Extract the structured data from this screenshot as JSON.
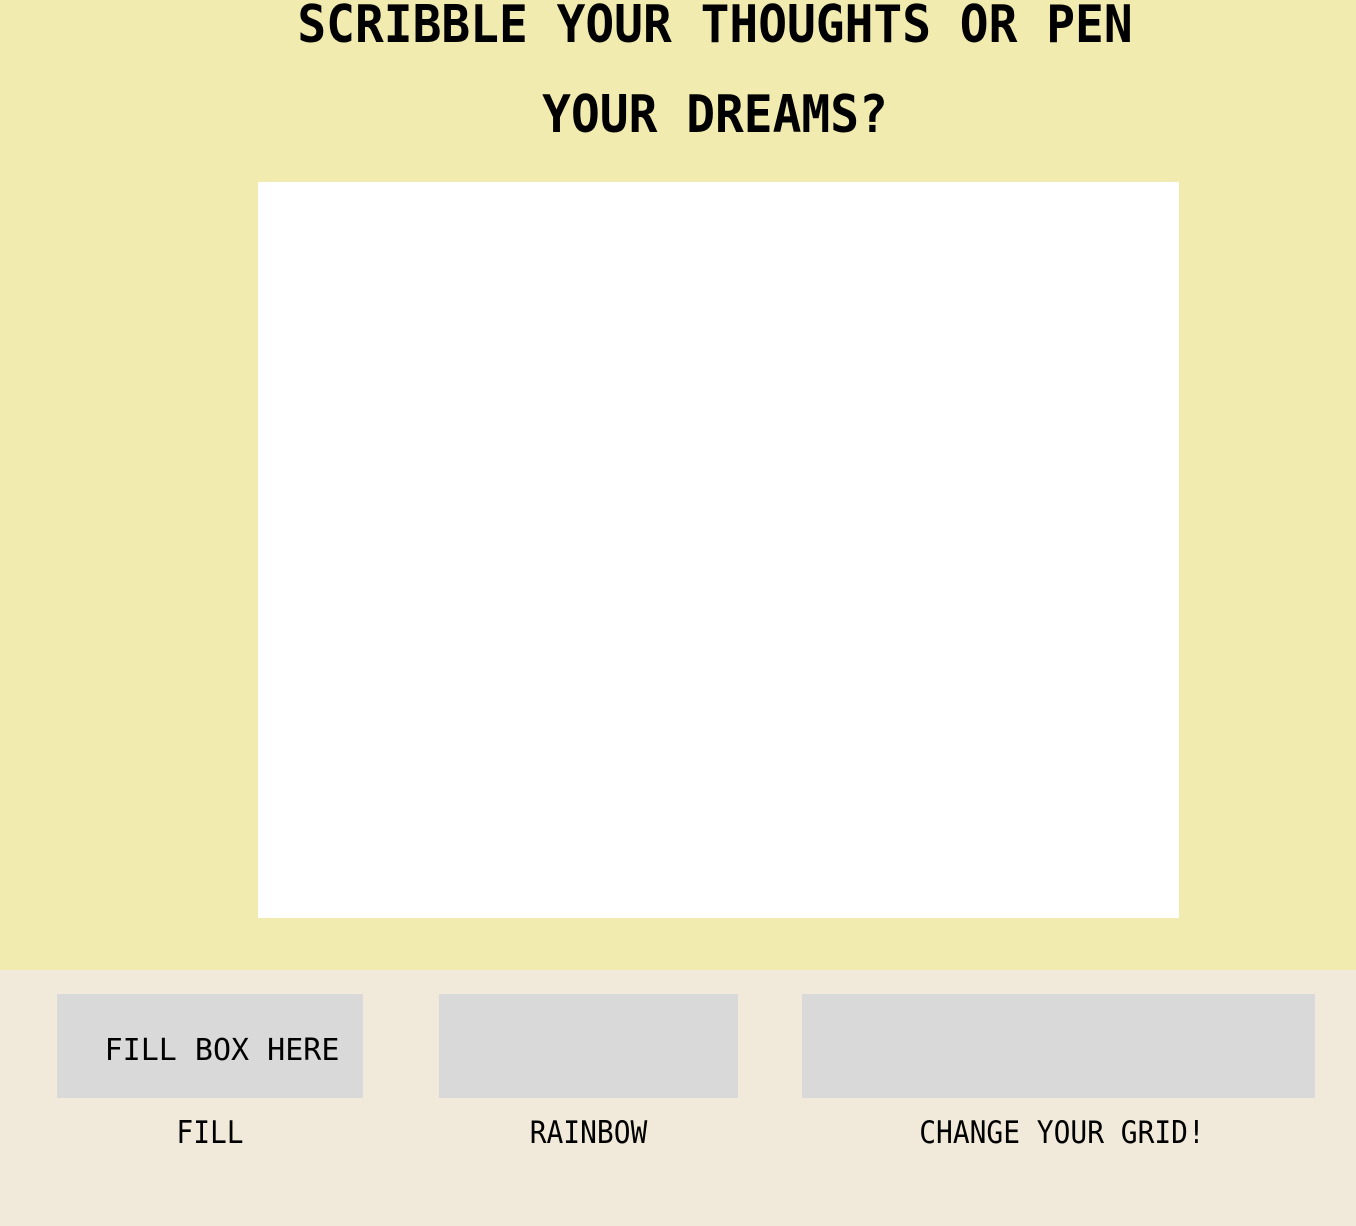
{
  "header": {
    "title": "SCRIBBLE YOUR THOUGHTS OR PEN YOUR DREAMS?"
  },
  "controls": {
    "fill_input_placeholder": "FILL BOX HERE",
    "fill_label": "FILL",
    "rainbow_label": "RAINBOW",
    "grid_label": "CHANGE YOUR GRID!"
  },
  "colors": {
    "top_background": "#f1ebb0",
    "bottom_background": "#f1eada",
    "canvas": "#ffffff",
    "control_box": "#d9d9d9"
  }
}
